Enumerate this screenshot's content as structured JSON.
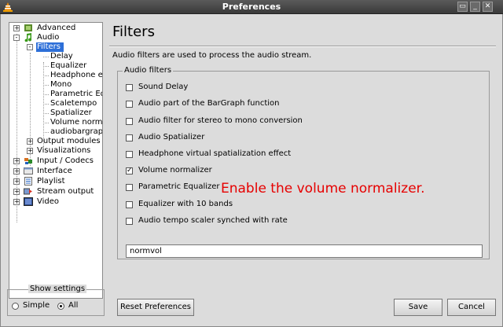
{
  "window": {
    "title": "Preferences"
  },
  "tree": {
    "items": [
      {
        "label": "Advanced",
        "icon": "advanced-icon",
        "level": 0,
        "expander": "+"
      },
      {
        "label": "Audio",
        "icon": "audio-icon",
        "level": 0,
        "expander": "-"
      },
      {
        "label": "Filters",
        "level": 1,
        "expander": "-",
        "selected": true
      },
      {
        "label": "Delay",
        "level": 2
      },
      {
        "label": "Equalizer",
        "level": 2
      },
      {
        "label": "Headphone effect",
        "level": 2
      },
      {
        "label": "Mono",
        "level": 2
      },
      {
        "label": "Parametric Equalizer",
        "level": 2
      },
      {
        "label": "Scaletempo",
        "level": 2
      },
      {
        "label": "Spatializer",
        "level": 2
      },
      {
        "label": "Volume normalizer",
        "level": 2
      },
      {
        "label": "audiobargraph_a",
        "level": 2
      },
      {
        "label": "Output modules",
        "level": 1,
        "expander": "+"
      },
      {
        "label": "Visualizations",
        "level": 1,
        "expander": "+"
      },
      {
        "label": "Input / Codecs",
        "icon": "input-codecs-icon",
        "level": 0,
        "expander": "+"
      },
      {
        "label": "Interface",
        "icon": "interface-icon",
        "level": 0,
        "expander": "+"
      },
      {
        "label": "Playlist",
        "icon": "playlist-icon",
        "level": 0,
        "expander": "+"
      },
      {
        "label": "Stream output",
        "icon": "stream-output-icon",
        "level": 0,
        "expander": "+"
      },
      {
        "label": "Video",
        "icon": "video-icon",
        "level": 0,
        "expander": "+"
      }
    ]
  },
  "show_settings": {
    "legend": "Show settings",
    "simple_label": "Simple",
    "all_label": "All",
    "selected": "All"
  },
  "panel": {
    "title": "Filters",
    "description": "Audio filters are used to process the audio stream.",
    "group_legend": "Audio filters",
    "filters": [
      {
        "label": "Sound Delay",
        "checked": false
      },
      {
        "label": "Audio part of the BarGraph function",
        "checked": false
      },
      {
        "label": "Audio filter for stereo to mono conversion",
        "checked": false
      },
      {
        "label": "Audio Spatializer",
        "checked": false
      },
      {
        "label": "Headphone virtual spatialization effect",
        "checked": false
      },
      {
        "label": "Volume normalizer",
        "checked": true
      },
      {
        "label": "Parametric Equalizer",
        "checked": false
      },
      {
        "label": "Equalizer with 10 bands",
        "checked": false
      },
      {
        "label": "Audio tempo scaler synched with rate",
        "checked": false
      }
    ],
    "filter_string_value": "normvol"
  },
  "instruction": "Enable the volume normalizer.",
  "buttons": {
    "reset": "Reset Preferences",
    "save": "Save",
    "cancel": "Cancel"
  }
}
